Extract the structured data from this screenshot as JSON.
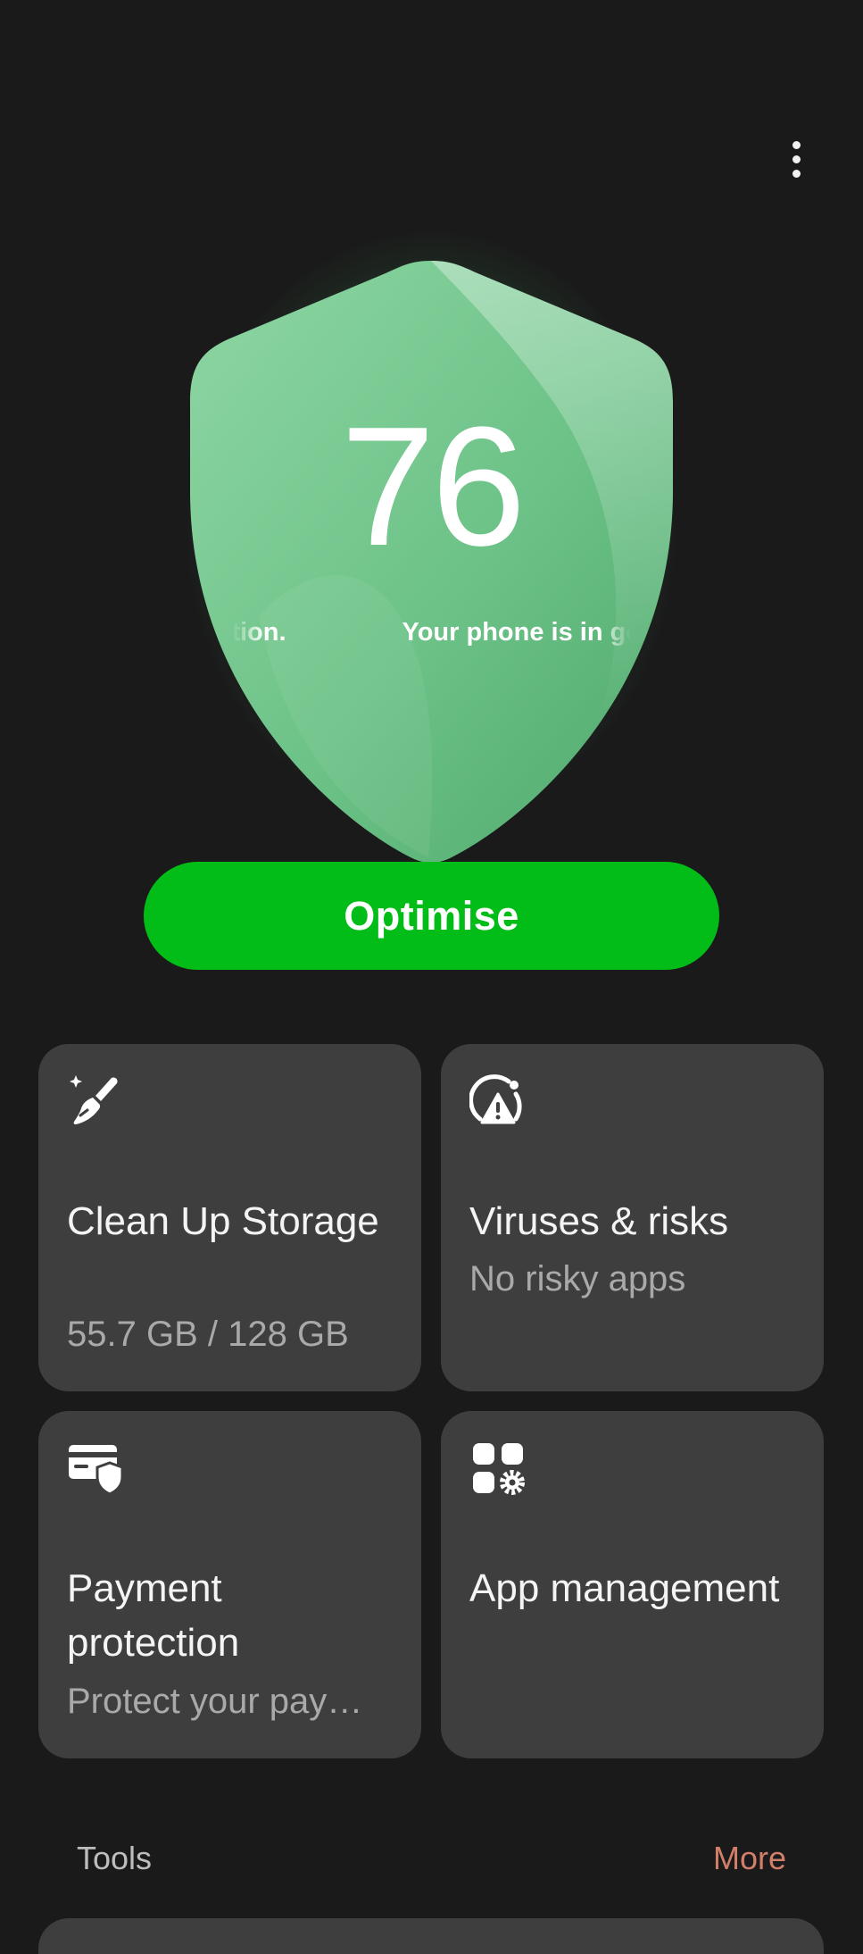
{
  "header": {
    "menu_icon": "more-vertical-icon"
  },
  "status": {
    "score": "76",
    "ticker_text": "Your phone is in good condition.",
    "shield_color": "#6fc58c"
  },
  "actions": {
    "optimise_label": "Optimise",
    "optimise_color": "#02bd18"
  },
  "cards": [
    {
      "icon": "broom-sparkle-icon",
      "title": "Clean Up Storage",
      "subtitle": "55.7 GB / 128 GB"
    },
    {
      "icon": "warning-radar-icon",
      "title": "Viruses & risks",
      "subtitle": "No risky apps"
    },
    {
      "icon": "card-shield-icon",
      "title": "Payment protection",
      "subtitle": "Protect your pay…"
    },
    {
      "icon": "apps-gear-icon",
      "title": "App management",
      "subtitle": ""
    }
  ],
  "tools": {
    "label": "Tools",
    "more_label": "More",
    "more_color": "#d27f6a"
  }
}
